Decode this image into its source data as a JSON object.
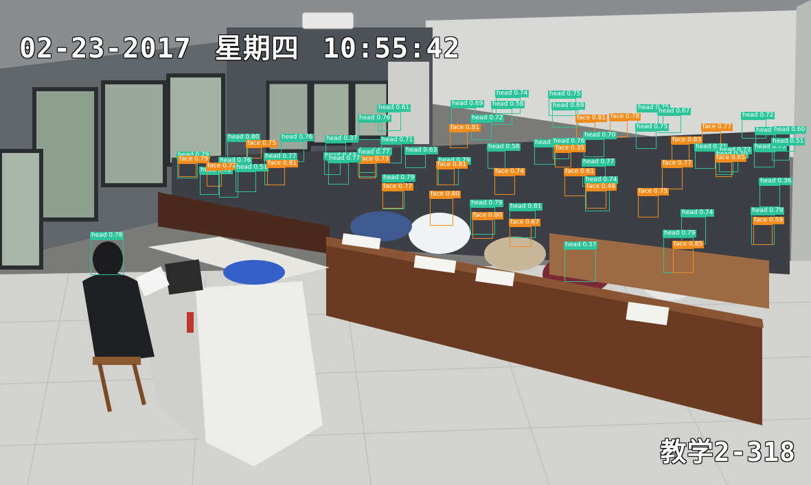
{
  "overlay": {
    "date": "02-23-2017",
    "weekday": "星期四",
    "time": "10:55:42",
    "room": "教学2-318"
  },
  "classes": {
    "head": {
      "label": "head",
      "color": "#2ec49b"
    },
    "face": {
      "label": "face",
      "color": "#f28c1c"
    }
  },
  "detections": [
    {
      "cls": "head",
      "score": "0.74"
    },
    {
      "cls": "head",
      "score": "0.75"
    },
    {
      "cls": "head",
      "score": "0.69"
    },
    {
      "cls": "head",
      "score": "0.58"
    },
    {
      "cls": "head",
      "score": "0.69"
    },
    {
      "cls": "head",
      "score": "0.61"
    },
    {
      "cls": "head",
      "score": "0.75"
    },
    {
      "cls": "head",
      "score": "0.67"
    },
    {
      "cls": "head",
      "score": "0.72"
    },
    {
      "cls": "head",
      "score": "0.76"
    },
    {
      "cls": "head",
      "score": "0.72"
    },
    {
      "cls": "face",
      "score": "0.81"
    },
    {
      "cls": "face",
      "score": "0.81"
    },
    {
      "cls": "face",
      "score": "0.78"
    },
    {
      "cls": "head",
      "score": "0.75"
    },
    {
      "cls": "face",
      "score": "0.77"
    },
    {
      "cls": "head",
      "score": "0.73"
    },
    {
      "cls": "head",
      "score": "0.60"
    },
    {
      "cls": "head",
      "score": "0.80"
    },
    {
      "cls": "face",
      "score": "0.75"
    },
    {
      "cls": "head",
      "score": "0.76"
    },
    {
      "cls": "head",
      "score": "0.37"
    },
    {
      "cls": "head",
      "score": "0.71"
    },
    {
      "cls": "head",
      "score": "0.65"
    },
    {
      "cls": "head",
      "score": "0.70"
    },
    {
      "cls": "face",
      "score": "0.83"
    },
    {
      "cls": "head",
      "score": "0.71"
    },
    {
      "cls": "head",
      "score": "0.75"
    },
    {
      "cls": "head",
      "score": "0.51"
    },
    {
      "cls": "head",
      "score": "0.79"
    },
    {
      "cls": "face",
      "score": "0.79"
    },
    {
      "cls": "head",
      "score": "0.76"
    },
    {
      "cls": "head",
      "score": "0.72"
    },
    {
      "cls": "face",
      "score": "0.72"
    },
    {
      "cls": "head",
      "score": "0.51"
    },
    {
      "cls": "head",
      "score": "0.77"
    },
    {
      "cls": "face",
      "score": "0.81"
    },
    {
      "cls": "head",
      "score": "0.47"
    },
    {
      "cls": "head",
      "score": "0.72"
    },
    {
      "cls": "head",
      "score": "0.63"
    },
    {
      "cls": "head",
      "score": "0.77"
    },
    {
      "cls": "face",
      "score": "0.73"
    },
    {
      "cls": "head",
      "score": "0.79"
    },
    {
      "cls": "face",
      "score": "0.81"
    },
    {
      "cls": "head",
      "score": "0.58"
    },
    {
      "cls": "head",
      "score": "0.76"
    },
    {
      "cls": "face",
      "score": "0.35"
    },
    {
      "cls": "head",
      "score": "0.77"
    },
    {
      "cls": "head",
      "score": "0.72"
    },
    {
      "cls": "head",
      "score": "0.70"
    },
    {
      "cls": "face",
      "score": "0.65"
    },
    {
      "cls": "face",
      "score": "0.77"
    },
    {
      "cls": "head",
      "score": "0.36"
    },
    {
      "cls": "head",
      "score": "0.79"
    },
    {
      "cls": "face",
      "score": "0.77"
    },
    {
      "cls": "face",
      "score": "0.74"
    },
    {
      "cls": "face",
      "score": "0.61"
    },
    {
      "cls": "head",
      "score": "0.74"
    },
    {
      "cls": "face",
      "score": "0.48"
    },
    {
      "cls": "head",
      "score": "0.77"
    },
    {
      "cls": "face",
      "score": "0.80"
    },
    {
      "cls": "head",
      "score": "0.79"
    },
    {
      "cls": "head",
      "score": "0.81"
    },
    {
      "cls": "face",
      "score": "0.75"
    },
    {
      "cls": "head",
      "score": "0.74"
    },
    {
      "cls": "head",
      "score": "0.79"
    },
    {
      "cls": "face",
      "score": "0.80"
    },
    {
      "cls": "face",
      "score": "0.67"
    },
    {
      "cls": "face",
      "score": "0.59"
    },
    {
      "cls": "head",
      "score": "0.78"
    },
    {
      "cls": "head",
      "score": "0.37"
    },
    {
      "cls": "head",
      "score": "0.79"
    },
    {
      "cls": "face",
      "score": "0.85"
    }
  ]
}
